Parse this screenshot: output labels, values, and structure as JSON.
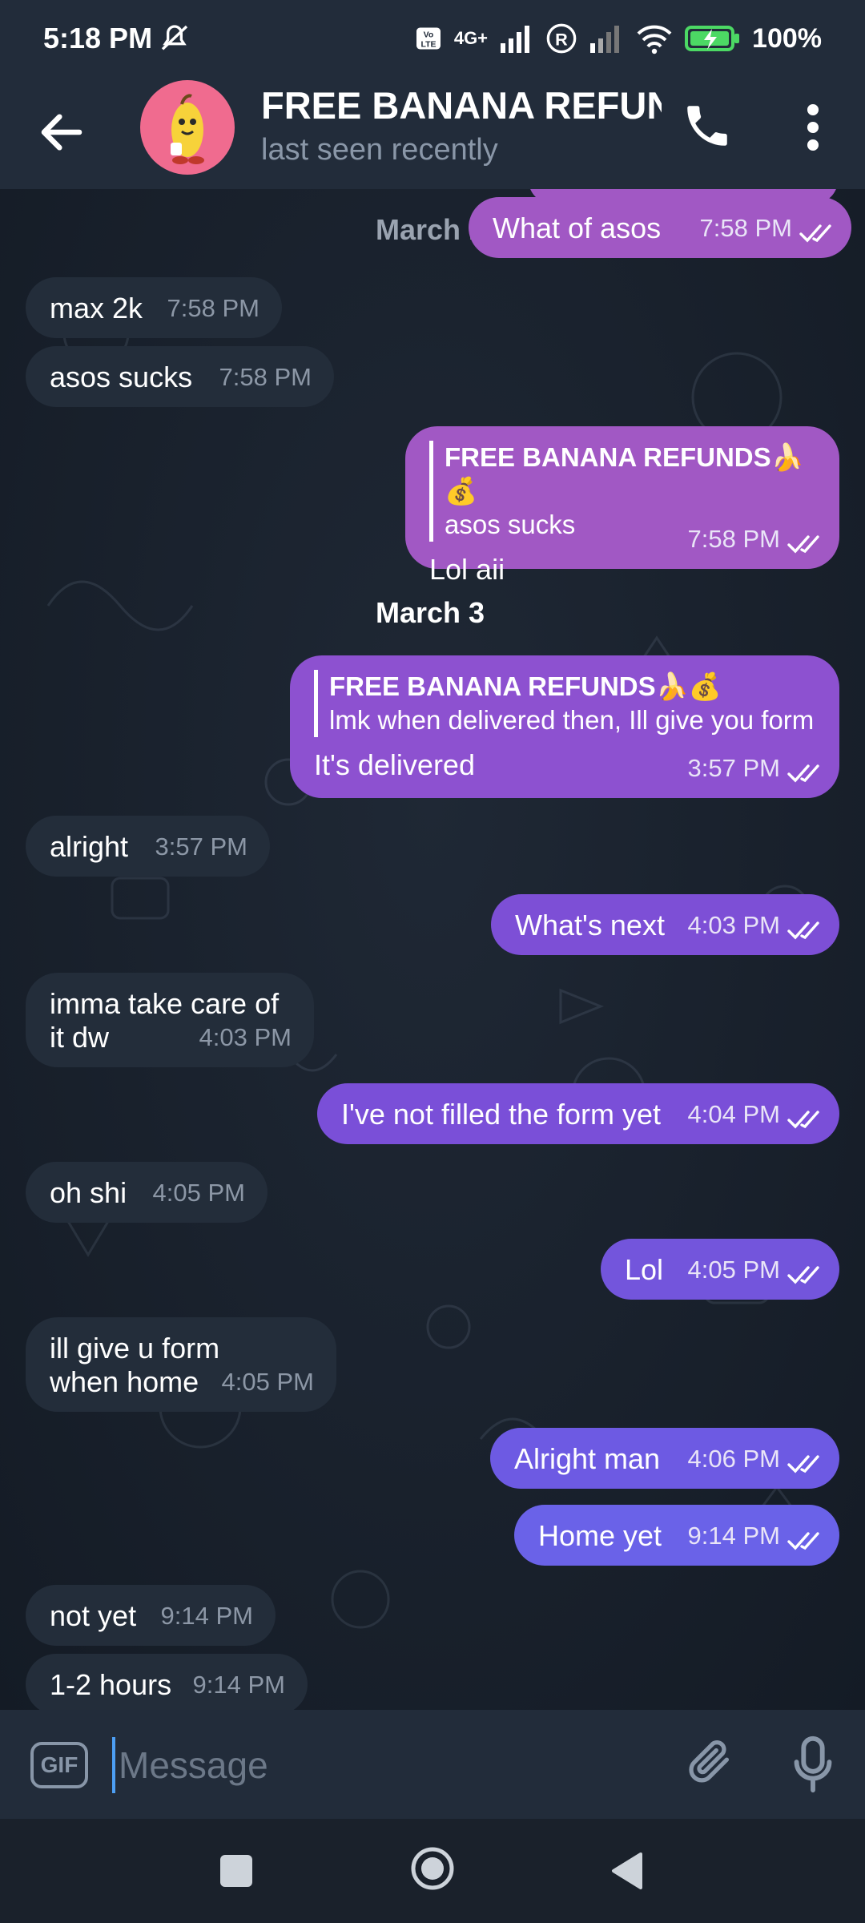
{
  "status_bar": {
    "time": "5:18 PM",
    "network": "4G+",
    "battery": "100%"
  },
  "header": {
    "title": "FREE BANANA REFUN",
    "subtitle": "last seen recently"
  },
  "messages": [
    {
      "dir": "out",
      "text": "What of asos",
      "time": "7:58 PM"
    },
    {
      "dir": "in",
      "text": "max 2k",
      "time": "7:58 PM"
    },
    {
      "dir": "in",
      "text": "asos sucks",
      "time": "7:58 PM"
    },
    {
      "dir": "out",
      "reply_author": "FREE BANANA REFUNDS🍌💰",
      "reply_text": "asos sucks",
      "text": "Lol aii",
      "time": "7:58 PM"
    },
    {
      "dir": "out",
      "reply_author": "FREE BANANA REFUNDS🍌💰",
      "reply_text": "lmk when delivered then, Ill give you form",
      "text": "It's delivered",
      "time": "3:57 PM"
    },
    {
      "dir": "in",
      "text": "alright",
      "time": "3:57 PM"
    },
    {
      "dir": "out",
      "text": "What's next",
      "time": "4:03 PM"
    },
    {
      "dir": "in",
      "text_line1": "imma take care of",
      "text_line2": "it dw",
      "time": "4:03 PM"
    },
    {
      "dir": "out",
      "text": "I've not filled the form yet",
      "time": "4:04 PM"
    },
    {
      "dir": "in",
      "text": "oh shi",
      "time": "4:05 PM"
    },
    {
      "dir": "out",
      "text": "Lol",
      "time": "4:05 PM"
    },
    {
      "dir": "in",
      "text_line1": "ill give u form",
      "text_line2": "when home",
      "time": "4:05 PM"
    },
    {
      "dir": "out",
      "text": "Alright man",
      "time": "4:06 PM"
    },
    {
      "dir": "out",
      "text": "Home yet",
      "time": "9:14 PM"
    },
    {
      "dir": "in",
      "text": "not yet",
      "time": "9:14 PM"
    },
    {
      "dir": "in",
      "text": "1-2 hours",
      "time": "9:14 PM"
    }
  ],
  "dates": {
    "march_1": "March 1",
    "march_3": "March 3"
  },
  "input": {
    "placeholder": "Message",
    "gif_label": "GIF"
  },
  "colors": {
    "bubble_in": "#232d3a",
    "bubble_out_pink": "#a158c4",
    "bubble_out_purple": "#7a4fd8",
    "bubble_out_blue": "#6e60e6",
    "background": "#1b2330"
  }
}
